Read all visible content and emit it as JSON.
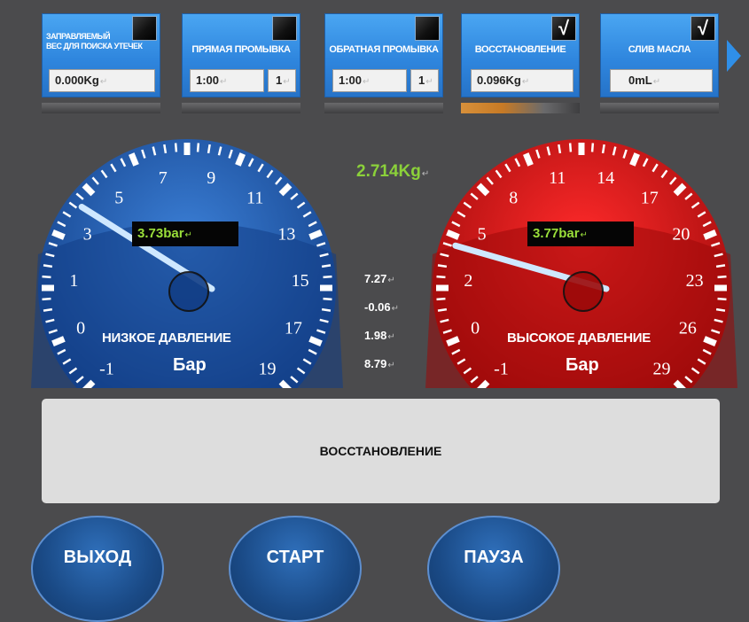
{
  "cards": [
    {
      "title": "ЗАПРАВЛЯЕМЫЙ ВЕС ДЛЯ ПОИСКА УТЕЧЕК",
      "title_line1": "ЗАПРАВЛЯЕМЫЙ",
      "title_line2": "ВЕС ДЛЯ ПОИСКА УТЕЧЕК",
      "value": "0.000Kg",
      "checked": false
    },
    {
      "title": "ПРЯМАЯ ПРОМЫВКА",
      "value": "1:00",
      "count": "1",
      "checked": false
    },
    {
      "title": "ОБРАТНАЯ ПРОМЫВКА",
      "value": "1:00",
      "count": "1",
      "checked": false
    },
    {
      "title": "ВОССТАНОВЛЕНИЕ",
      "value": "0.096Kg",
      "checked": true
    },
    {
      "title": "СЛИВ МАСЛА",
      "value": "0mL",
      "checked": true
    }
  ],
  "check_mark": "√",
  "return_mark": "↵",
  "low_gauge": {
    "label": "НИЗКОЕ ДАВЛЕНИЕ",
    "unit": "Бар",
    "readout": "3.73bar",
    "value": 3.73,
    "range": [
      -1,
      19
    ],
    "ticks": [
      "-1",
      "0",
      "1",
      "3",
      "5",
      "7",
      "9",
      "11",
      "13",
      "15",
      "17",
      "19"
    ],
    "color": "#1f56a8"
  },
  "high_gauge": {
    "label": "ВЫСОКОЕ ДАВЛЕНИЕ",
    "unit": "Бар",
    "readout": "3.77bar",
    "value": 3.77,
    "range": [
      -1,
      29
    ],
    "ticks": [
      "-1",
      "0",
      "2",
      "5",
      "8",
      "11",
      "14",
      "17",
      "20",
      "23",
      "26",
      "29"
    ],
    "color": "#e01414"
  },
  "center": {
    "weight": "2.714Kg",
    "values": [
      "7.27",
      "-0.06",
      "1.98",
      "8.79"
    ]
  },
  "status_text": "ВОССТАНОВЛЕНИЕ",
  "buttons": {
    "exit": "ВЫХОД",
    "start": "СТАРТ",
    "pause": "ПАУЗА"
  },
  "colors": {
    "card_blue": "#2f86de",
    "readout_green": "#9adf3a",
    "background": "#4b4b4d"
  }
}
